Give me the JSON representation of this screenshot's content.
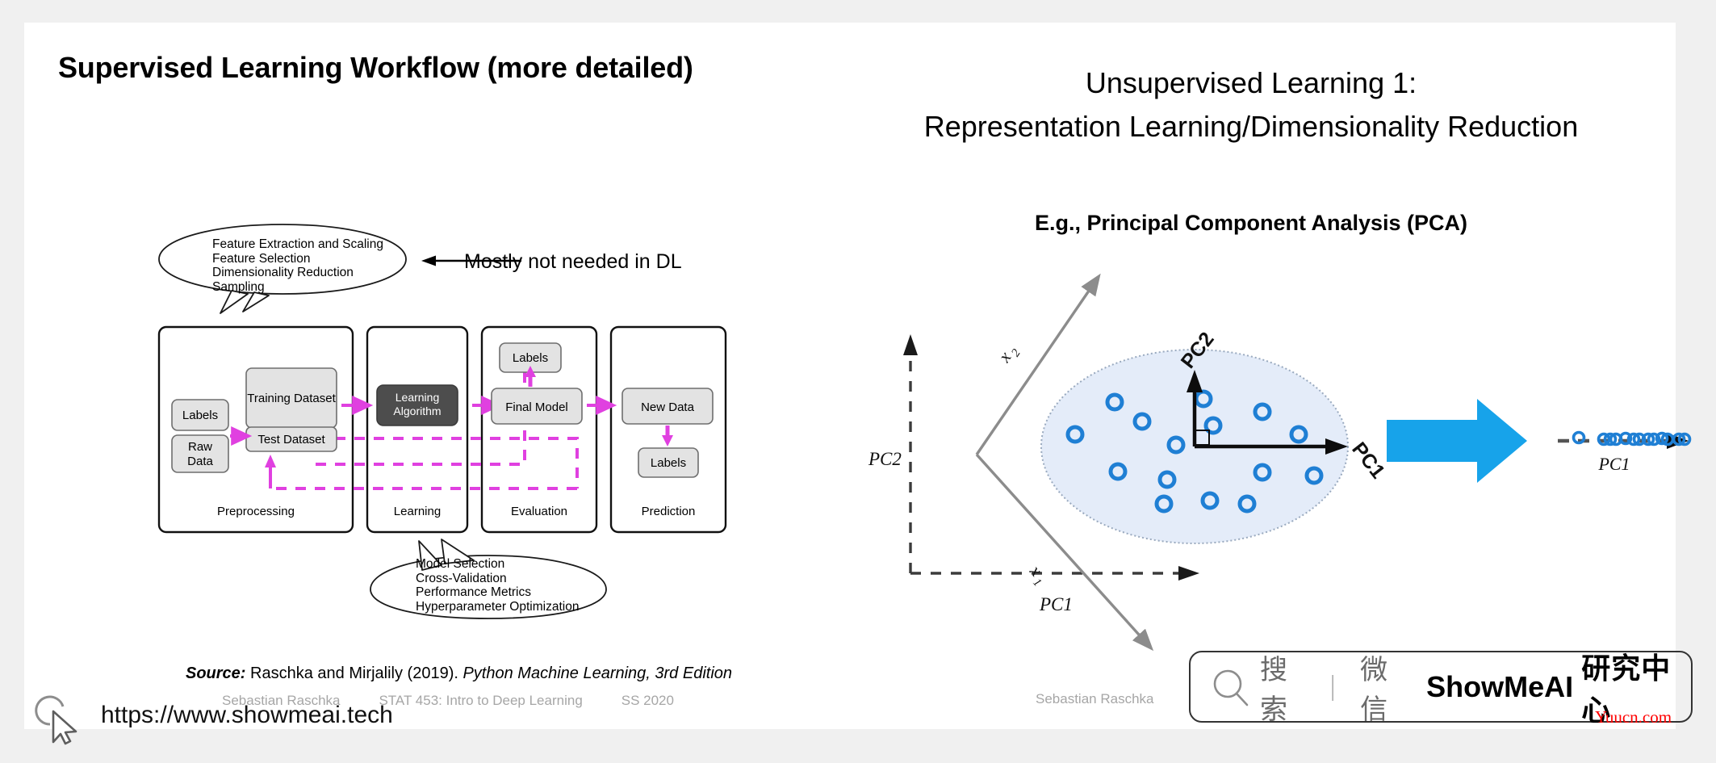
{
  "slide": {
    "left": {
      "title": "Supervised Learning Workflow (more detailed)",
      "top_bubble": "Feature Extraction and Scaling\nFeature Selection\nDimensionality Reduction\nSampling",
      "annotation": "Mostly not needed in DL",
      "bottom_bubble": "Model Selection\nCross-Validation\nPerformance Metrics\nHyperparameter Optimization",
      "workflow": {
        "stages": [
          {
            "name": "Preprocessing",
            "label": "Preprocessing"
          },
          {
            "name": "Learning",
            "label": "Learning"
          },
          {
            "name": "Evaluation",
            "label": "Evaluation"
          },
          {
            "name": "Prediction",
            "label": "Prediction"
          }
        ],
        "boxes": {
          "labels_pre": "Labels",
          "raw_data": "Raw\nData",
          "raw_data_line1": "Raw",
          "raw_data_line2": "Data",
          "training_dataset": "Training Dataset",
          "test_dataset": "Test Dataset",
          "learning_algorithm_line1": "Learning",
          "learning_algorithm_line2": "Algorithm",
          "labels_eval": "Labels",
          "final_model": "Final Model",
          "new_data": "New Data",
          "labels_pred": "Labels"
        },
        "colors": {
          "box_fill": "#e3e3e3",
          "dark_fill": "#4d4d4d",
          "flow": "#e040e0",
          "stroke": "#5a5a5a"
        }
      },
      "source_prefix": "Source:",
      "source_mid": " Raschka and Mirjalily (2019). ",
      "source_italic": "Python Machine Learning, 3rd Edition",
      "footer": {
        "author": "Sebastian Raschka",
        "course": "STAT 453: Intro to Deep Learning",
        "term": "SS 2020"
      }
    },
    "right": {
      "title_line1": "Unsupervised Learning 1:",
      "title_line2": "Representation Learning/Dimensionality Reduction",
      "subtitle": "E.g., Principal Component Analysis (PCA)",
      "author": "Sebastian Raschka",
      "figure": {
        "axis_pc2_left": "PC2",
        "axis_pc1_bottom": "PC1",
        "axis_x2": "x₂",
        "axis_x1": "x₁",
        "vec_pc2": "PC2",
        "vec_pc1": "PC1",
        "projected_axis_label": "PC1",
        "colors": {
          "point_stroke": "#1f7fd4",
          "ellipse_fill": "#e4ecf9",
          "ellipse_stroke": "#9aaabf",
          "gray_axis": "#8c8c8c",
          "dark_axis": "#1a1a1a",
          "big_arrow": "#17a3ea"
        },
        "cloud_points": [
          [
            -0.78,
            0.12
          ],
          [
            -0.52,
            0.46
          ],
          [
            -0.34,
            0.26
          ],
          [
            -0.12,
            -0.02
          ],
          [
            0.06,
            0.5
          ],
          [
            0.12,
            0.22
          ],
          [
            0.44,
            0.38
          ],
          [
            0.68,
            0.14
          ],
          [
            -0.5,
            -0.26
          ],
          [
            -0.18,
            -0.34
          ],
          [
            0.1,
            -0.56
          ],
          [
            0.34,
            -0.6
          ],
          [
            0.44,
            -0.26
          ],
          [
            0.78,
            -0.3
          ],
          [
            -0.14,
            -0.6
          ]
        ],
        "projected_points": [
          0.06,
          0.29,
          0.33,
          0.37,
          0.45,
          0.5,
          0.54,
          0.62,
          0.66,
          0.78,
          0.82,
          0.92,
          0.96
        ]
      },
      "watermark": {
        "search_cn": "搜索",
        "separator": "｜",
        "wechat_cn": "微信",
        "brand": "ShowMeAI",
        "brand_cn": "研究中心",
        "magnifier_icon": "search-icon"
      }
    }
  },
  "bottom": {
    "url": "https://www.showmeai.tech",
    "cursor_icon": "cursor-pointer-icon",
    "credit": "Yuucn.com"
  }
}
